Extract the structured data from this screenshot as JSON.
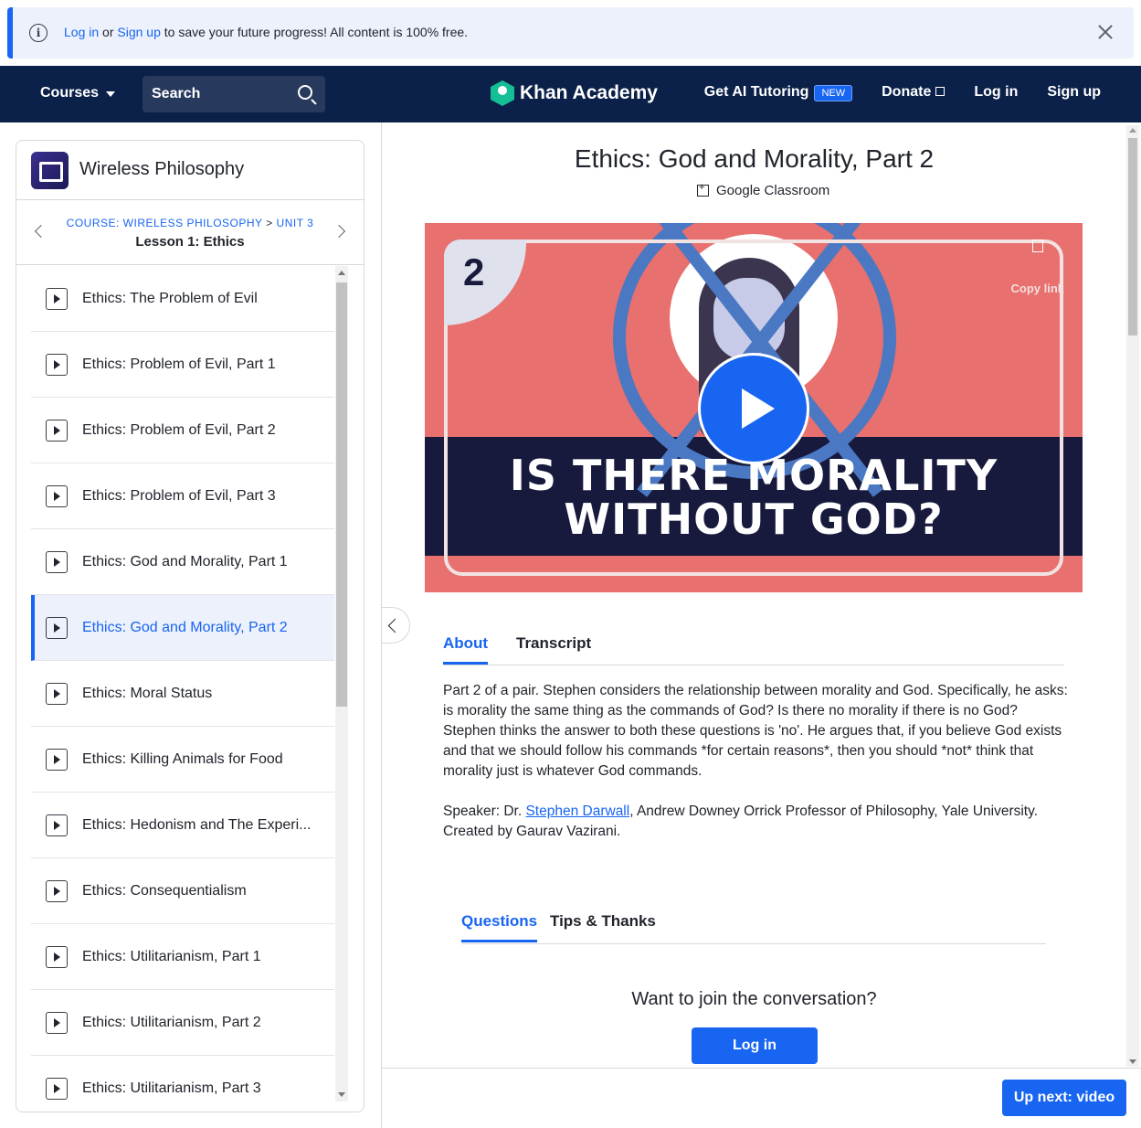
{
  "banner": {
    "login": "Log in",
    "or": "or",
    "signup": "Sign up",
    "rest": "to save your future progress! All content is 100% free."
  },
  "nav": {
    "courses": "Courses",
    "search": "Search",
    "logo": "Khan Academy",
    "ai_tutoring": "Get AI Tutoring",
    "new_badge": "NEW",
    "donate": "Donate",
    "login": "Log in",
    "signup": "Sign up"
  },
  "sidebar": {
    "course_title": "Wireless Philosophy",
    "breadcrumb_course": "COURSE: WIRELESS PHILOSOPHY",
    "breadcrumb_sep": ">",
    "breadcrumb_unit": "UNIT 3",
    "lesson": "Lesson 1: Ethics",
    "items": [
      {
        "label": "Ethics: The Problem of Evil"
      },
      {
        "label": "Ethics: Problem of Evil, Part 1"
      },
      {
        "label": "Ethics: Problem of Evil, Part 2"
      },
      {
        "label": "Ethics: Problem of Evil, Part 3"
      },
      {
        "label": "Ethics: God and Morality, Part 1"
      },
      {
        "label": "Ethics: God and Morality, Part 2"
      },
      {
        "label": "Ethics: Moral Status"
      },
      {
        "label": "Ethics: Killing Animals for Food"
      },
      {
        "label": "Ethics: Hedonism and The Experi..."
      },
      {
        "label": "Ethics: Consequentialism"
      },
      {
        "label": "Ethics: Utilitarianism, Part 1"
      },
      {
        "label": "Ethics: Utilitarianism, Part 2"
      },
      {
        "label": "Ethics: Utilitarianism, Part 3"
      }
    ]
  },
  "main": {
    "title": "Ethics: God and Morality, Part 2",
    "google_classroom": "Google Classroom",
    "video": {
      "number": "2",
      "headline_1": "IS THERE MORALITY",
      "headline_2": "WITHOUT GOD?",
      "copy_link": "Copy link"
    },
    "tabs": {
      "about": "About",
      "transcript": "Transcript"
    },
    "about_p1": "Part 2 of a pair. Stephen considers the relationship between morality and God. Specifically, he asks: is morality the same thing as the commands of God? Is there no morality if there is no God? Stephen thinks the answer to both these questions is 'no'. He argues that, if you believe God exists and that we should follow his commands *for certain reasons*, then you should *not* think that morality just is whatever God commands.",
    "speaker_prefix": "Speaker: Dr. ",
    "speaker_link": "Stephen Darwall",
    "speaker_suffix": ", Andrew Downey Orrick Professor of Philosophy, Yale University.",
    "created_by": "Created by Gaurav Vazirani.",
    "tabs2": {
      "questions": "Questions",
      "tips": "Tips & Thanks"
    },
    "join": "Want to join the conversation?",
    "login_button": "Log in",
    "up_next": "Up next: video"
  },
  "colors": {
    "accent": "#1865f2",
    "nav_bg": "#0b2149",
    "active_bg": "#edf1fb"
  }
}
